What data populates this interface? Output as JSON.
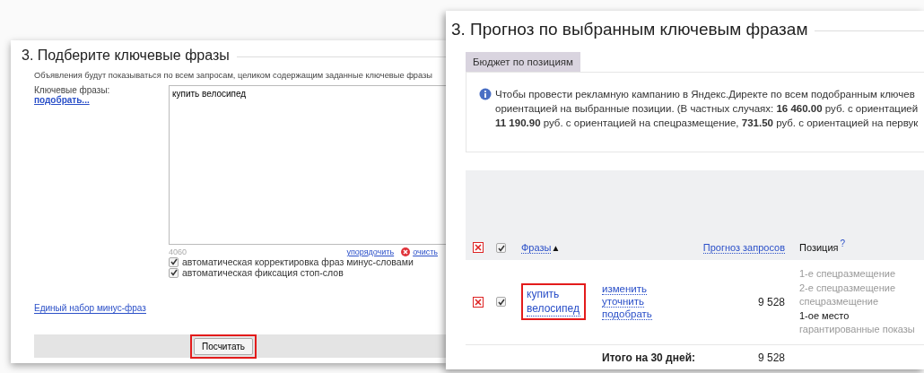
{
  "left_panel": {
    "title": "3. Подберите ключевые фразы",
    "description": "Объявления будут показываться по всем запросам, целиком содержащим заданные ключевые фразы",
    "keywords_label": "Ключевые фразы:",
    "pick_link": "подобрать...",
    "keywords_value": "купить велосипед",
    "char_count": "4060",
    "sort_link": "упорядочить",
    "clear_link": "очисть",
    "options": [
      {
        "label": "автоматическая корректировка фраз минус-словами",
        "checked": true
      },
      {
        "label": "автоматическая фиксация стоп-слов",
        "checked": true
      }
    ],
    "minus_phrases_link": "Единый набор минус-фраз",
    "calculate_button": {
      "label": "Посчитать",
      "highlighted": true
    }
  },
  "right_panel": {
    "title": "3. Прогноз по выбранным ключевым фразам",
    "tabs": [
      {
        "label": "Бюджет по позициям",
        "selected": true
      }
    ],
    "info_lines": [
      "Чтобы провести рекламную кампанию в Яндекс.Директе по всем подобранным ключев",
      "ориентацией на выбранные позиции. (В частных случаях: **16 460.00** руб. с ориентацией",
      "**11 190.90** руб. с ориентацией на спецразмещение, **731.50** руб. с ориентацией на первук"
    ],
    "table": {
      "header": {
        "checked": true,
        "phrases": "Фразы",
        "sort_mark": "▲",
        "forecast": "Прогноз запросов",
        "position": "Позиция",
        "help": "?"
      },
      "rows": [
        {
          "checked": true,
          "phrase": "купить велосипед",
          "highlighted": true,
          "actions": [
            "изменить",
            "уточнить",
            "подобрать"
          ],
          "forecast": "9 528",
          "positions": [
            {
              "label": "1-е спецразмещение",
              "selected": false
            },
            {
              "label": "2-е спецразмещение",
              "selected": false
            },
            {
              "label": "спецразмещение",
              "selected": false
            },
            {
              "label": "1-ое место",
              "selected": true
            },
            {
              "label": "гарантированные показы",
              "selected": false
            }
          ]
        }
      ],
      "total_label": "Итого на 30 дней:",
      "total_forecast": "9 528"
    }
  }
}
